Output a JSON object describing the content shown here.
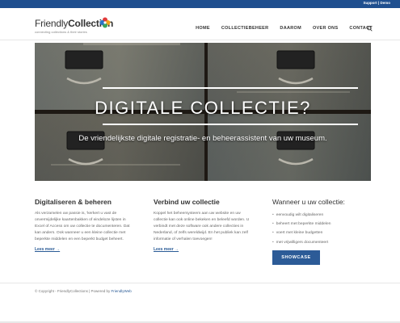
{
  "topbar": {
    "support": "Support",
    "separator": "|",
    "demo": "Demo"
  },
  "logo": {
    "name_regular": "Friendly",
    "name_bold": "Collection",
    "tagline": "connecting collections & their stories"
  },
  "nav": {
    "items": [
      "HOME",
      "COLLECTIEBEHEER",
      "DAAROM",
      "OVER ONS",
      "CONTACT"
    ],
    "search_icon": "search-icon"
  },
  "hero": {
    "title": "DIGITALE COLLECTIE?",
    "subtitle": "De vriendelijkste digitale registratie- en beheerassistent van uw museum."
  },
  "col1": {
    "heading": "Digitaliseren & beheren",
    "text": "Als verzamelen uw passie is, 'kerkert u vast de onvermijdelijke kaartenbakken of eindeloze lijsten in Excel of Access om uw collectie te documenteren. Dat kan anders. Ook wanneer u een kleine collectie met beperkte middelen en een beperkt budget beheert.",
    "more": "Lees meer →"
  },
  "col2": {
    "heading": "Verbind uw collectie",
    "text": "Koppel het beheersysteem aan uw website en uw collectie kan ook online bekeken en beleefd worden. U verbindt met deze software ook andere collecties in Nederland, of zelfs wereldwijd. En het publiek kan zelf informatie of verhalen toevoegen!",
    "more": "Lees meer →"
  },
  "col3": {
    "heading": "Wanneer u uw collectie:",
    "items": [
      "eenvoudig wilt digitaliseren",
      "beheert met beperkte middelen",
      "voert met kleine budgetten",
      "met vrijwilligers documenteert"
    ],
    "button": "SHOWCASE"
  },
  "footer": {
    "text": "© Copyright - FriendlyCollections | Powered by ",
    "link": "FriendlyWeb"
  },
  "colors": {
    "brand_blue": "#1f4f8f",
    "button_blue": "#2c5b97",
    "link_blue": "#2a5b96"
  }
}
